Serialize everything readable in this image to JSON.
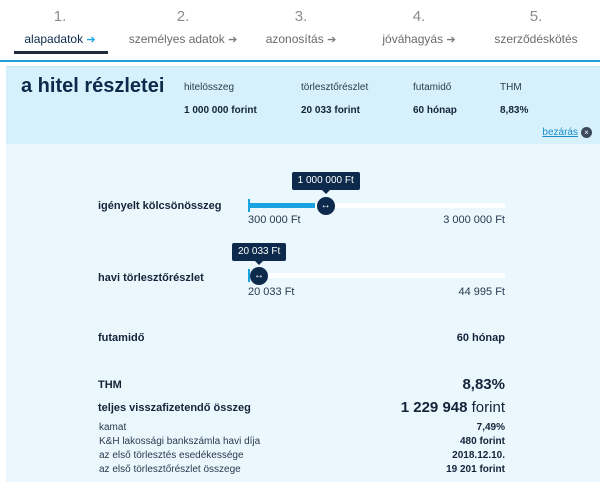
{
  "steps": [
    {
      "num": "1.",
      "label": "alapadatok",
      "arrow": "➔",
      "active": true
    },
    {
      "num": "2.",
      "label": "személyes adatok",
      "arrow": "➔",
      "active": false
    },
    {
      "num": "3.",
      "label": "azonosítás",
      "arrow": "➔",
      "active": false
    },
    {
      "num": "4.",
      "label": "jóváhagyás",
      "arrow": "➔",
      "active": false
    },
    {
      "num": "5.",
      "label": "szerződéskötés",
      "arrow": "",
      "active": false
    }
  ],
  "summary": {
    "title": "a hitel részletei",
    "columns": [
      {
        "label": "hitelösszeg",
        "value": "1 000 000 forint"
      },
      {
        "label": "törlesztőrészlet",
        "value": "20 033 forint"
      },
      {
        "label": "futamidő",
        "value": "60 hónap"
      },
      {
        "label": "THM",
        "value": "8,83%"
      }
    ],
    "close_label": "bezárás",
    "close_icon": "×"
  },
  "loan_slider": {
    "label": "igényelt kölcsönösszeg",
    "tooltip": "1 000 000 Ft",
    "min_label": "300 000 Ft",
    "max_label": "3 000 000 Ft",
    "min": 300000,
    "max": 3000000,
    "value": 1000000,
    "handle_icon": "↔"
  },
  "installment_slider": {
    "label": "havi törlesztőrészlet",
    "tooltip": "20 033 Ft",
    "min_label": "20 033 Ft",
    "max_label": "44 995 Ft",
    "min": 20033,
    "max": 44995,
    "value": 20033,
    "handle_icon": "↔"
  },
  "term": {
    "label": "futamidő",
    "value": "60 hónap"
  },
  "thm": {
    "label": "THM",
    "value": "8,83%"
  },
  "total": {
    "label": "teljes visszafizetendő összeg",
    "amount": "1 229 948",
    "unit": "forint"
  },
  "breakdown": [
    {
      "label": "kamat",
      "value": "7,49%"
    },
    {
      "label": "K&H lakossági bankszámla havi díja",
      "value": "480 forint"
    },
    {
      "label": "az első törlesztés esedékessége",
      "value": "2018.12.10."
    },
    {
      "label": "az első törlesztőrészlet összege",
      "value": "19 201 forint"
    }
  ],
  "colors": {
    "accent": "#1aa3e0",
    "navy": "#0d2a4c",
    "band": "#d6f1fb",
    "panel": "#eaf7fd"
  }
}
